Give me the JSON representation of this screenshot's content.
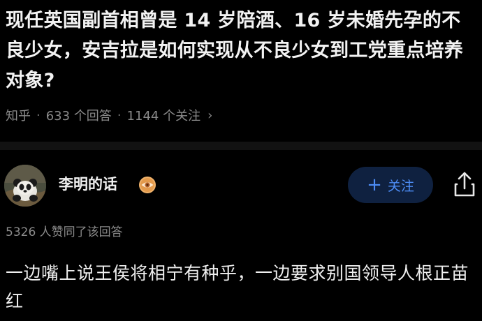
{
  "question": {
    "title": "现任英国副首相曾是 14 岁陪酒、16 岁未婚先孕的不良少女，安吉拉是如何实现从不良少女到工党重点培养对象?",
    "site": "知乎",
    "answers": "633 个回答",
    "followers": "1144 个关注",
    "chevron": "›"
  },
  "answer": {
    "author": "李明的话",
    "badge_icon": "eye-badge-icon",
    "follow_plus": "+",
    "follow_label": "关注",
    "share_icon": "share-icon",
    "vote_text": "5326 人赞同了该回答",
    "content": "一边嘴上说王侯将相宁有种乎，一边要求别国领导人根正苗红"
  },
  "colors": {
    "background": "#000000",
    "text_primary": "#f2f2f2",
    "text_secondary": "#8a8a8a",
    "follow_bg": "#0f2140",
    "follow_text": "#4d8df6",
    "badge": "#e8a25a"
  }
}
